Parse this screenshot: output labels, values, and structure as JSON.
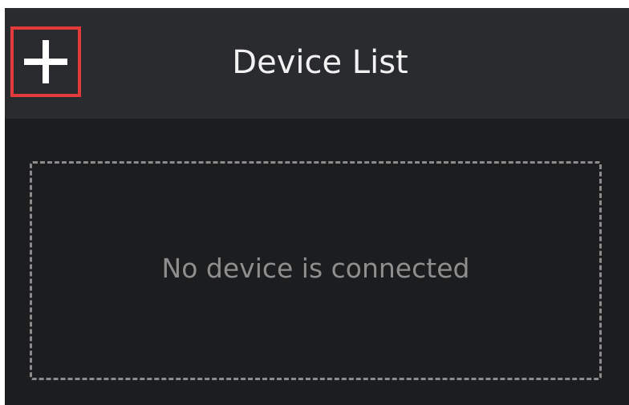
{
  "header": {
    "title": "Device List",
    "add_button_icon": "plus-icon"
  },
  "device_list": {
    "empty_message": "No device is connected",
    "devices": []
  },
  "colors": {
    "background": "#1c1d1f",
    "header_background": "#2a2b2e",
    "highlight_border": "#e33b3b",
    "title_text": "#f2f2f2",
    "empty_text": "#8e8e8e"
  }
}
